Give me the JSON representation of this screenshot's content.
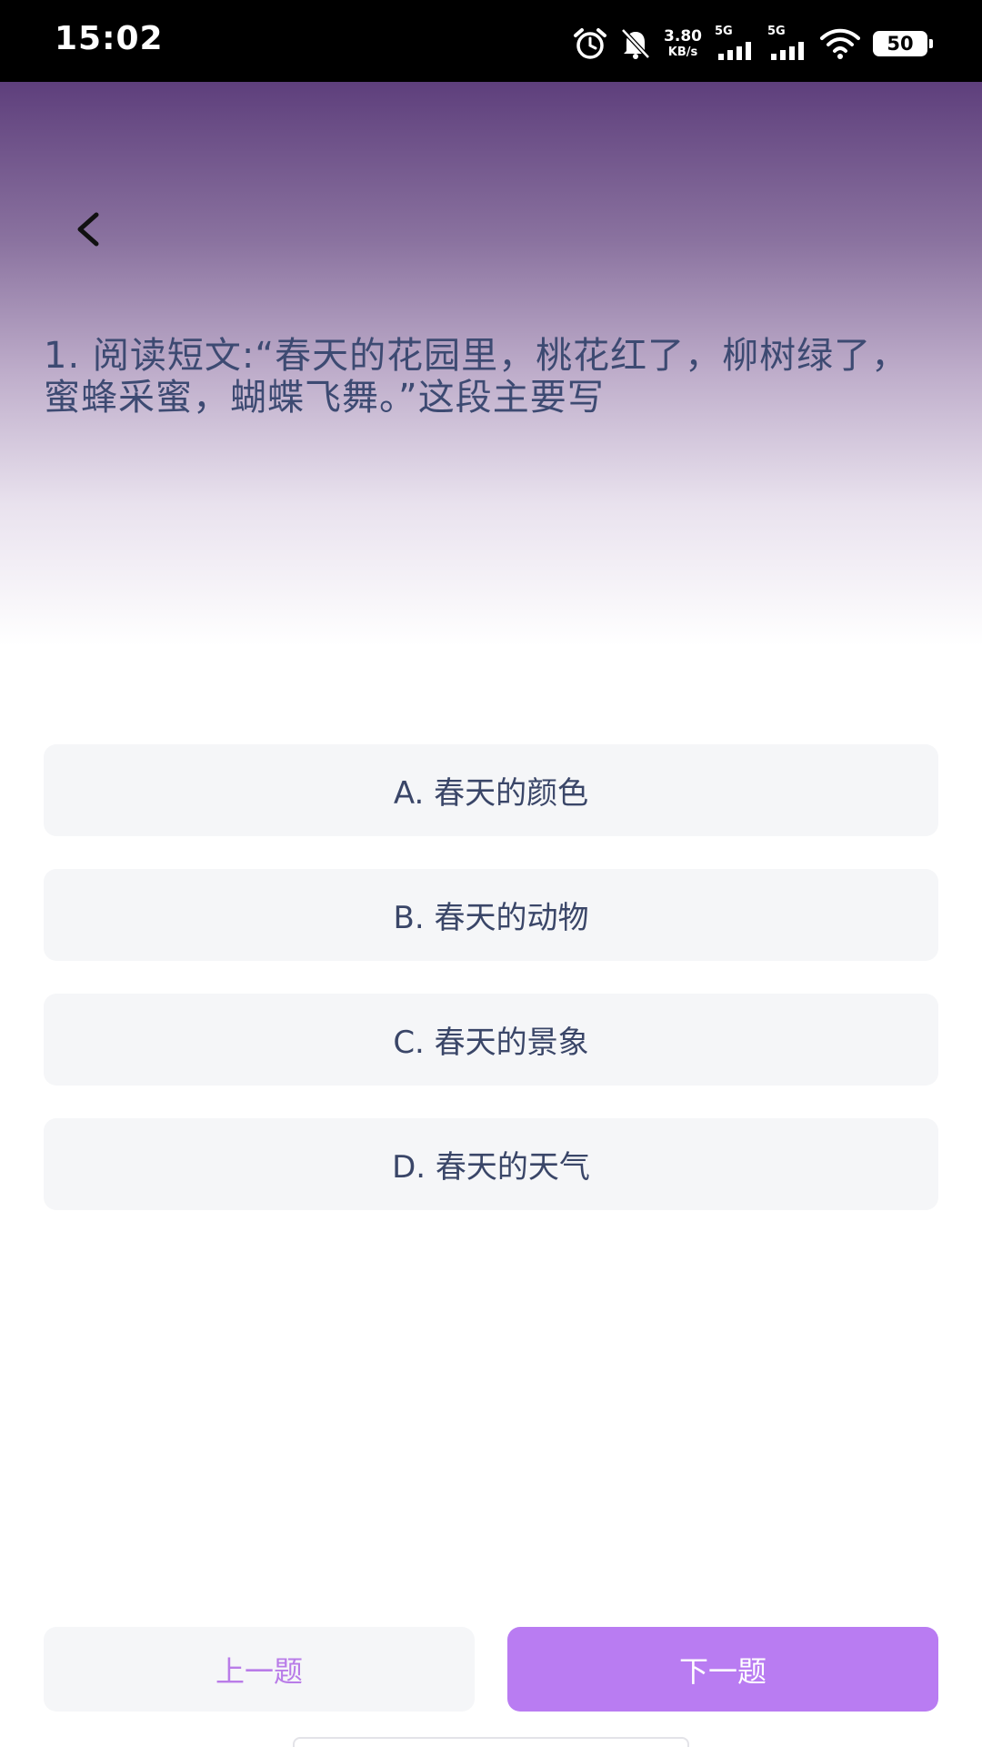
{
  "status_bar": {
    "time": "15:02",
    "net_speed_value": "3.80",
    "net_speed_unit": "KB/s",
    "sim1_label": "5G",
    "sim2_label": "5G",
    "battery_level": "50",
    "icons": [
      "alarm-icon",
      "bell-muted-icon",
      "signal-icon",
      "signal-icon",
      "wifi-icon",
      "battery-icon"
    ]
  },
  "header": {
    "back_icon": "chevron-left-icon",
    "question": "1. 阅读短文:“春天的花园里，桃花红了，柳树绿了，蜜蜂采蜜，蝴蝶飞舞。”这段主要写"
  },
  "options": [
    {
      "label": "A. 春天的颜色"
    },
    {
      "label": "B. 春天的动物"
    },
    {
      "label": "C. 春天的景象"
    },
    {
      "label": "D. 春天的天气"
    }
  ],
  "nav": {
    "prev_label": "上一题",
    "next_label": "下一题"
  },
  "colors": {
    "header_top": "#5e3f7c",
    "question_text": "#3d4a72",
    "option_bg": "#f5f6f8",
    "accent": "#b97cf2"
  }
}
